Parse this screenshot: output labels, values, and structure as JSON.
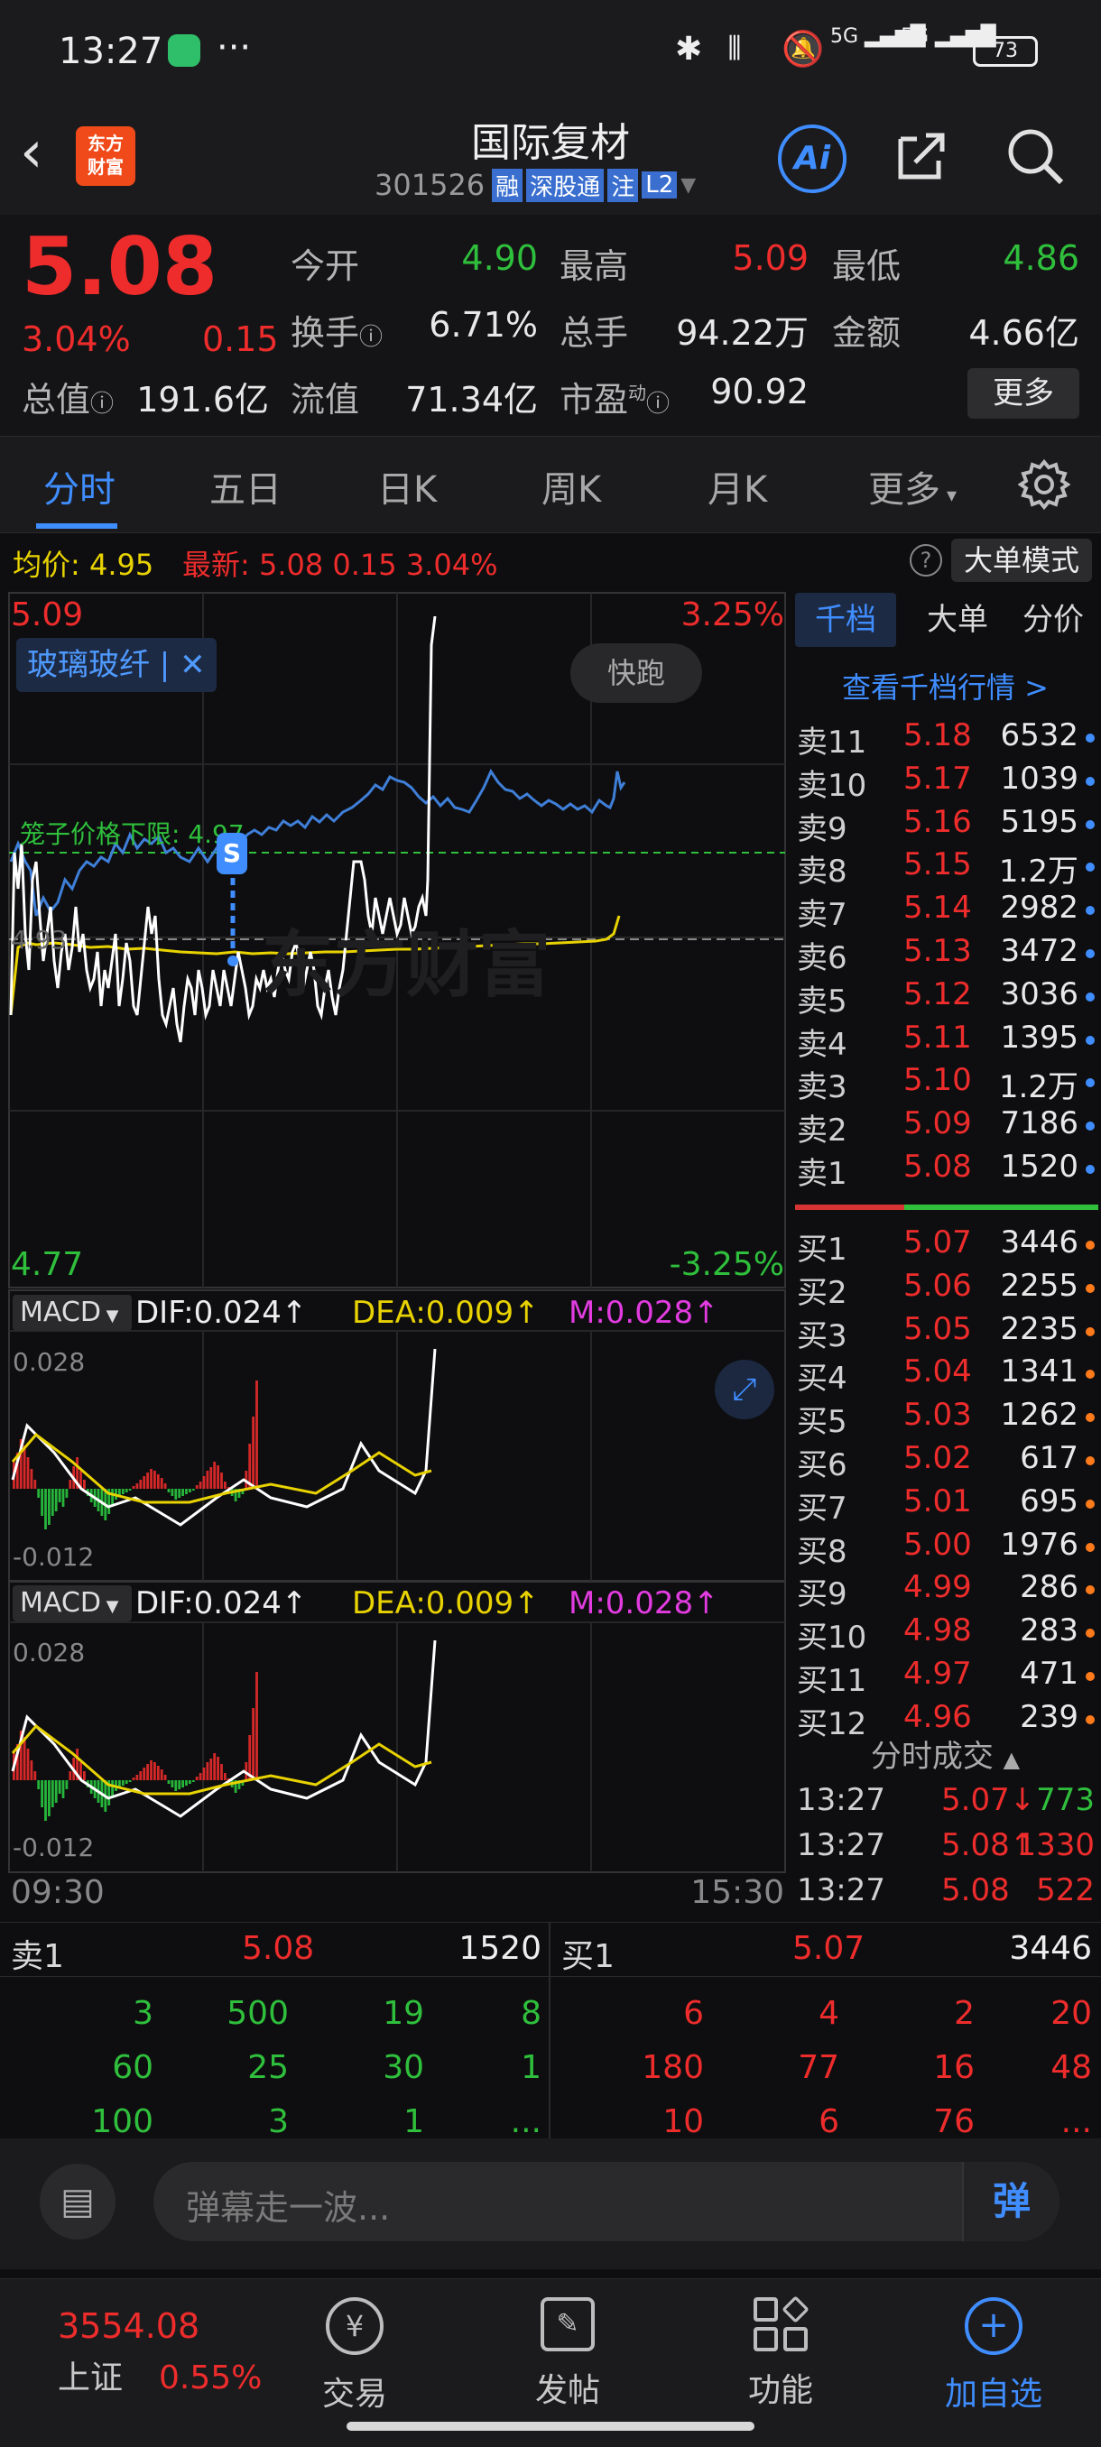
{
  "status": {
    "time": "13:27",
    "dots": "···",
    "battery": "73",
    "net1": "5G",
    "net2": "5G"
  },
  "nav": {
    "title": "国际复材",
    "code": "301526",
    "tags": [
      "融",
      "深股通",
      "注",
      "L2"
    ],
    "logo": "东方\n财富",
    "ai": "Ai"
  },
  "quote": {
    "price": "5.08",
    "pct": "3.04%",
    "chg": "0.15",
    "stats": [
      {
        "label": "今开",
        "value": "4.90",
        "color": "green"
      },
      {
        "label": "最高",
        "value": "5.09",
        "color": "red"
      },
      {
        "label": "最低",
        "value": "4.86",
        "color": "green"
      },
      {
        "label": "换手",
        "value": "6.71%",
        "color": "white"
      },
      {
        "label": "总手",
        "value": "94.22万",
        "color": "white"
      },
      {
        "label": "金额",
        "value": "4.66亿",
        "color": "white"
      },
      {
        "label": "总值",
        "value": "191.6亿",
        "color": "white"
      },
      {
        "label": "流值",
        "value": "71.34亿",
        "color": "white"
      },
      {
        "label": "市盈",
        "value": "90.92",
        "color": "white"
      }
    ],
    "more": "更多",
    "pe_sup": "动"
  },
  "tabs": [
    "分时",
    "五日",
    "日K",
    "周K",
    "月K",
    "更多",
    "gear"
  ],
  "avg": {
    "label": "均价:",
    "avg": "4.95",
    "latest_label": "最新:",
    "latest": "5.08",
    "chg": "0.15",
    "pct": "3.04%",
    "mode": "大单模式"
  },
  "chart": {
    "top_price": "5.09",
    "top_pct": "3.25%",
    "bottom_price": "4.77",
    "bottom_pct": "-3.25%",
    "mid_price": "4.93",
    "sector": "玻璃玻纤 |",
    "kuaipao": "快跑",
    "limit_label": "笼子价格下限: 4.97",
    "watermark": "东方财富",
    "time_start": "09:30",
    "time_end": "15:30",
    "marker": "S"
  },
  "macd": [
    {
      "name": "MACD",
      "dif": "DIF:0.024",
      "dea": "DEA:0.009",
      "m": "M:0.028",
      "top": "0.028",
      "bottom": "-0.012"
    },
    {
      "name": "MACD",
      "dif": "DIF:0.024",
      "dea": "DEA:0.009",
      "m": "M:0.028",
      "top": "0.028",
      "bottom": "-0.012"
    }
  ],
  "orderbook": {
    "tabs": [
      "千档",
      "大单",
      "分价"
    ],
    "link": "查看千档行情 >",
    "asks": [
      {
        "l": "卖11",
        "p": "5.18",
        "v": "6532",
        "c": "#3f8dff"
      },
      {
        "l": "卖10",
        "p": "5.17",
        "v": "1039",
        "c": "#3f8dff"
      },
      {
        "l": "卖9",
        "p": "5.16",
        "v": "5195",
        "c": "#3f8dff"
      },
      {
        "l": "卖8",
        "p": "5.15",
        "v": "1.2万",
        "c": "#3f8dff"
      },
      {
        "l": "卖7",
        "p": "5.14",
        "v": "2982",
        "c": "#3f8dff"
      },
      {
        "l": "卖6",
        "p": "5.13",
        "v": "3472",
        "c": "#3f8dff"
      },
      {
        "l": "卖5",
        "p": "5.12",
        "v": "3036",
        "c": "#3f8dff"
      },
      {
        "l": "卖4",
        "p": "5.11",
        "v": "1395",
        "c": "#3f8dff"
      },
      {
        "l": "卖3",
        "p": "5.10",
        "v": "1.2万",
        "c": "#3f8dff"
      },
      {
        "l": "卖2",
        "p": "5.09",
        "v": "7186",
        "c": "#3f8dff"
      },
      {
        "l": "卖1",
        "p": "5.08",
        "v": "1520",
        "c": "#3f8dff"
      }
    ],
    "bids": [
      {
        "l": "买1",
        "p": "5.07",
        "v": "3446",
        "c": "#ff7a1a"
      },
      {
        "l": "买2",
        "p": "5.06",
        "v": "2255",
        "c": "#ff7a1a"
      },
      {
        "l": "买3",
        "p": "5.05",
        "v": "2235",
        "c": "#ff7a1a"
      },
      {
        "l": "买4",
        "p": "5.04",
        "v": "1341",
        "c": "#ff7a1a"
      },
      {
        "l": "买5",
        "p": "5.03",
        "v": "1262",
        "c": "#ff7a1a"
      },
      {
        "l": "买6",
        "p": "5.02",
        "v": "617",
        "c": "#ff7a1a"
      },
      {
        "l": "买7",
        "p": "5.01",
        "v": "695",
        "c": "#ff7a1a"
      },
      {
        "l": "买8",
        "p": "5.00",
        "v": "1976",
        "c": "#ff7a1a"
      },
      {
        "l": "买9",
        "p": "4.99",
        "v": "286",
        "c": "#ff7a1a"
      },
      {
        "l": "买10",
        "p": "4.98",
        "v": "283",
        "c": "#ff7a1a"
      },
      {
        "l": "买11",
        "p": "4.97",
        "v": "471",
        "c": "#ff7a1a"
      },
      {
        "l": "买12",
        "p": "4.96",
        "v": "239",
        "c": "#ff7a1a"
      }
    ],
    "trades_title": "分时成交",
    "trades": [
      {
        "t": "13:27",
        "p": "5.07↓",
        "v": "773",
        "pc": "#ee2c2c",
        "vc": "#2fbf3c"
      },
      {
        "t": "13:27",
        "p": "5.08↑",
        "v": "1330",
        "pc": "#ee2c2c",
        "vc": "#ee2c2c"
      },
      {
        "t": "13:27",
        "p": "5.08",
        "v": "522",
        "pc": "#ee2c2c",
        "vc": "#ee2c2c"
      }
    ]
  },
  "queue": {
    "sell_label": "卖1",
    "sell_price": "5.08",
    "sell_vol": "1520",
    "buy_label": "买1",
    "buy_price": "5.07",
    "buy_vol": "3446",
    "sell_rows": [
      [
        "3",
        "500",
        "19",
        "8"
      ],
      [
        "60",
        "25",
        "30",
        "1"
      ],
      [
        "100",
        "3",
        "1",
        "..."
      ]
    ],
    "buy_rows": [
      [
        "6",
        "4",
        "2",
        "20"
      ],
      [
        "180",
        "77",
        "16",
        "48"
      ],
      [
        "10",
        "6",
        "76",
        "..."
      ]
    ]
  },
  "comment": {
    "placeholder": "弹幕走一波...",
    "danmu": "弹"
  },
  "footer": {
    "index_value": "3554.08",
    "index_name": "上证",
    "index_pct": "0.55%",
    "items": [
      "交易",
      "发帖",
      "功能",
      "加自选"
    ]
  }
}
